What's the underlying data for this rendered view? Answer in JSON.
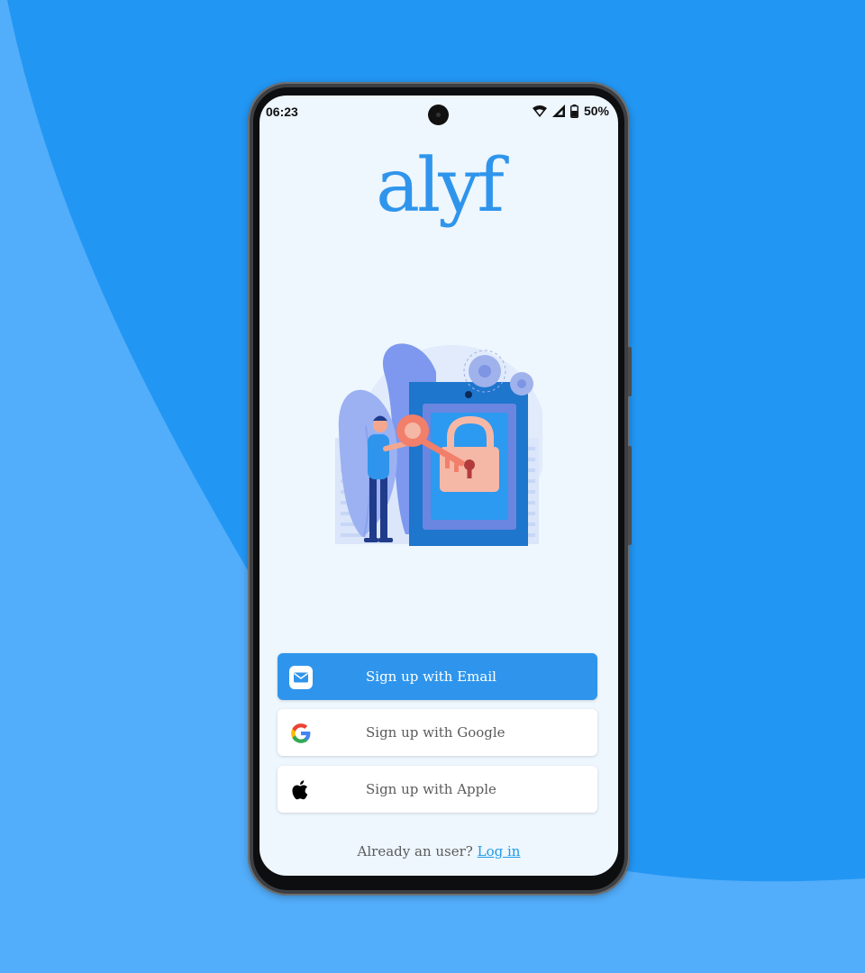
{
  "status_bar": {
    "time": "06:23",
    "battery": "50%"
  },
  "app": {
    "logo_text": "alyf"
  },
  "buttons": {
    "email": {
      "label": "Sign up with Email"
    },
    "google": {
      "label": "Sign up with Google"
    },
    "apple": {
      "label": "Sign up with Apple"
    }
  },
  "footer": {
    "prompt": "Already an user?",
    "login_link": "Log in"
  },
  "icons": [
    "mail-icon",
    "google-icon",
    "apple-icon",
    "wifi-icon",
    "signal-icon",
    "battery-icon"
  ],
  "colors": {
    "brand": "#2f95ec",
    "background_light": "#52adfa",
    "background_dark": "#2296f3",
    "screen": "#eef6fe"
  }
}
